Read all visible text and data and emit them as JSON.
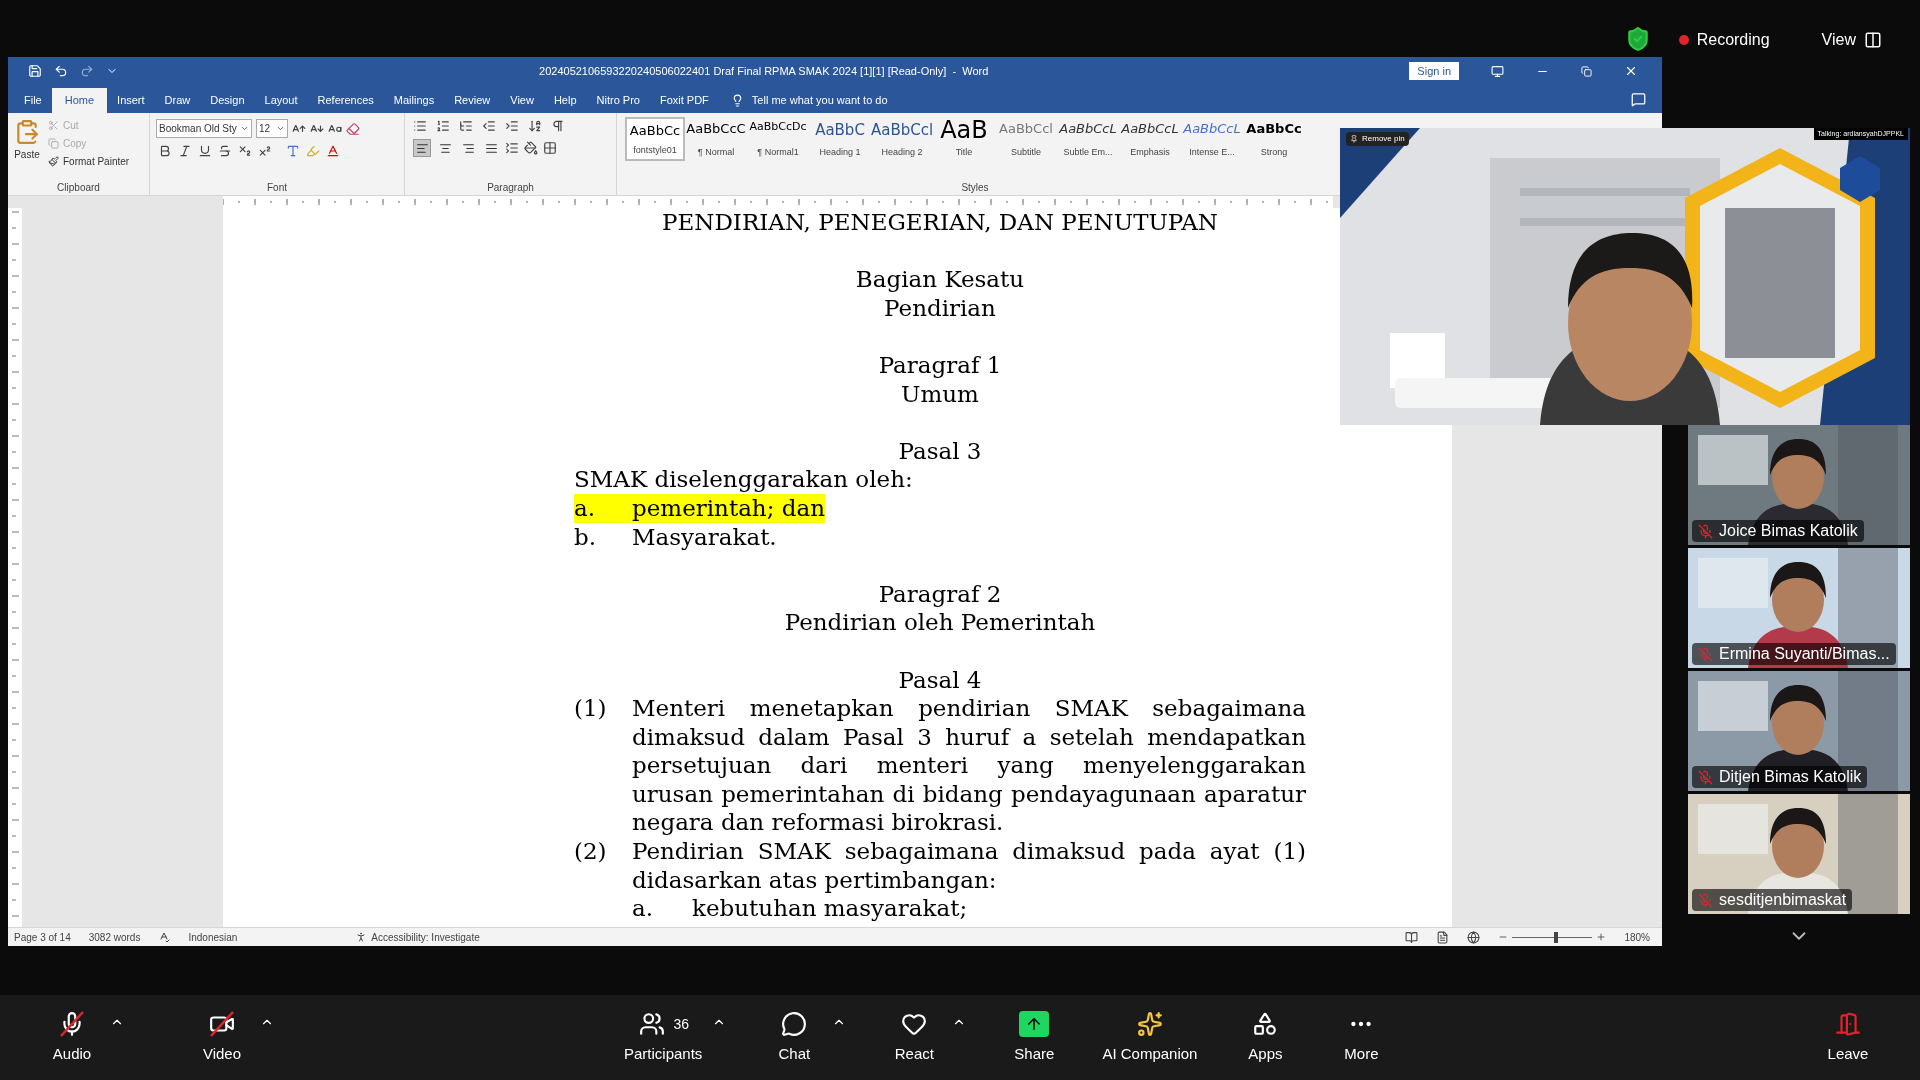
{
  "meeting_top": {
    "recording": {
      "label": "Recording",
      "active": true
    },
    "view": "View"
  },
  "word": {
    "title": "2024052106593220240506022401 Draf Final RPMA SMAK 2024 [1][1] [Read-Only]  -  Word",
    "sign_in": "Sign in",
    "tabs": [
      {
        "label": "File",
        "selected": false
      },
      {
        "label": "Home",
        "selected": true
      },
      {
        "label": "Insert",
        "selected": false
      },
      {
        "label": "Draw",
        "selected": false
      },
      {
        "label": "Design",
        "selected": false
      },
      {
        "label": "Layout",
        "selected": false
      },
      {
        "label": "References",
        "selected": false
      },
      {
        "label": "Mailings",
        "selected": false
      },
      {
        "label": "Review",
        "selected": false
      },
      {
        "label": "View",
        "selected": false
      },
      {
        "label": "Help",
        "selected": false
      },
      {
        "label": "Nitro Pro",
        "selected": false
      },
      {
        "label": "Foxit PDF",
        "selected": false
      }
    ],
    "tell_me": "Tell me what you want to do",
    "clipboard": {
      "label": "Clipboard",
      "paste": "Paste",
      "actions": [
        {
          "kind": "cut",
          "label": "Cut",
          "disabled": true
        },
        {
          "kind": "copy",
          "label": "Copy",
          "disabled": true
        },
        {
          "kind": "painter",
          "label": "Format Painter",
          "disabled": false
        }
      ]
    },
    "font": {
      "label": "Font",
      "name": "Bookman Old Sty",
      "size": "12"
    },
    "paragraph": {
      "label": "Paragraph",
      "align_buttons": [
        {
          "kind": "left",
          "selected": true
        },
        {
          "kind": "center",
          "selected": false
        },
        {
          "kind": "right",
          "selected": false
        },
        {
          "kind": "justify",
          "selected": false
        }
      ]
    },
    "styles": {
      "label": "Styles",
      "items": [
        {
          "preview": "AaBbCc",
          "name": "fontstyle01",
          "kind": "normal",
          "selected": true
        },
        {
          "preview": "AaBbCcC",
          "name": "¶ Normal",
          "kind": "normal",
          "selected": false
        },
        {
          "preview": "AaBbCcDc",
          "name": "¶ Normal1",
          "kind": "small",
          "selected": false
        },
        {
          "preview": "AaBbC",
          "name": "Heading 1",
          "kind": "heading",
          "selected": false
        },
        {
          "preview": "AaBbCcl",
          "name": "Heading 2",
          "kind": "heading",
          "selected": false
        },
        {
          "preview": "AaB",
          "name": "Title",
          "kind": "title",
          "selected": false
        },
        {
          "preview": "AaBbCcl",
          "name": "Subtitle",
          "kind": "subtle",
          "selected": false
        },
        {
          "preview": "AaBbCcL",
          "name": "Subtle Em...",
          "kind": "emphasis",
          "selected": false
        },
        {
          "preview": "AaBbCcL",
          "name": "Emphasis",
          "kind": "emphasis",
          "selected": false
        },
        {
          "preview": "AaBbCcL",
          "name": "Intense E...",
          "kind": "intense",
          "selected": false
        },
        {
          "preview": "AaBbCc",
          "name": "Strong",
          "kind": "strong",
          "selected": false
        }
      ]
    },
    "document": {
      "cut_heading": "PENDIRIAN, PENEGERIAN, DAN PENUTUPAN",
      "sections": [
        {
          "headings": [
            "Bagian Kesatu",
            "Pendirian"
          ]
        },
        {
          "headings": [
            "Paragraf 1",
            "Umum"
          ]
        },
        {
          "headings": [
            "Pasal 3"
          ],
          "body": [
            {
              "kind": "text",
              "text": "SMAK diselenggarakan oleh:"
            },
            {
              "kind": "item",
              "marker": "a.",
              "text": "pemerintah; dan",
              "highlighted": true
            },
            {
              "kind": "item",
              "marker": "b.",
              "text": "Masyarakat.",
              "highlighted": false
            }
          ]
        },
        {
          "headings": [
            "Paragraf 2",
            "Pendirian oleh Pemerintah"
          ]
        },
        {
          "headings": [
            "Pasal 4"
          ],
          "body": [
            {
              "kind": "numbered",
              "marker": "(1)",
              "text": "Menteri menetapkan pendirian SMAK sebagaimana dimaksud dalam Pasal 3 huruf a setelah mendapatkan persetujuan dari menteri yang menyelenggarakan urusan pemerintahan di bidang pendayagunaan aparatur negara dan reformasi birokrasi."
            },
            {
              "kind": "numbered",
              "marker": "(2)",
              "text": "Pendirian SMAK sebagaimana dimaksud pada ayat (1) didasarkan atas pertimbangan:"
            },
            {
              "kind": "subitem",
              "marker": "a.",
              "text": "kebutuhan masyarakat;"
            }
          ]
        }
      ]
    },
    "status": {
      "page": "Page 3 of 14",
      "words": "3082 words",
      "language": "Indonesian",
      "accessibility": "Accessibility: Investigate",
      "zoom": "180%",
      "level": 0.55
    }
  },
  "video": {
    "remove_pin": "Remove pin",
    "talking": "Talking: ardiansyahDJPPKL"
  },
  "participants": [
    {
      "name": "Joice Bimas Katolik",
      "muted": true
    },
    {
      "name": "Ermina Suyanti/Bimas...",
      "muted": true
    },
    {
      "name": "Ditjen Bimas Katolik",
      "muted": true
    },
    {
      "name": "sesditjenbimaskat",
      "muted": true
    }
  ],
  "toolbar": [
    {
      "kind": "audio",
      "label": "Audio",
      "slashed": true,
      "caret": true
    },
    {
      "kind": "video",
      "label": "Video",
      "slashed": true,
      "caret": true
    },
    {
      "kind": "participants",
      "label": "Participants",
      "count": "36",
      "slashed": false,
      "caret": true
    },
    {
      "kind": "chat",
      "label": "Chat",
      "slashed": false,
      "caret": true
    },
    {
      "kind": "react",
      "label": "React",
      "slashed": false,
      "caret": true
    },
    {
      "kind": "share",
      "label": "Share",
      "slashed": false,
      "caret": false
    },
    {
      "kind": "ai",
      "label": "AI Companion",
      "slashed": false,
      "caret": false
    },
    {
      "kind": "apps",
      "label": "Apps",
      "slashed": false,
      "caret": false
    },
    {
      "kind": "more",
      "label": "More",
      "slashed": false,
      "caret": false
    },
    {
      "kind": "leave",
      "label": "Leave",
      "slashed": false,
      "caret": false
    }
  ]
}
